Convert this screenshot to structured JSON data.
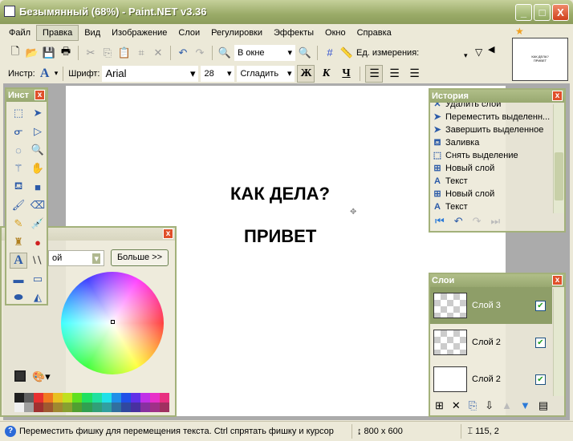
{
  "window": {
    "title": "Безымянный (68%) - Paint.NET v3.36",
    "min": "_",
    "max": "□",
    "close": "X"
  },
  "menu": [
    "Файл",
    "Правка",
    "Вид",
    "Изображение",
    "Слои",
    "Регулировки",
    "Эффекты",
    "Окно",
    "Справка"
  ],
  "menu_active": "Правка",
  "toolbar": {
    "zoom_value": "В окне",
    "units_label": "Ед. измерения:"
  },
  "textbar": {
    "tool_label": "Инстр:",
    "font_label": "Шрифт:",
    "font_value": "Arial",
    "size_value": "28",
    "antialias_value": "Сгладить",
    "bold": "Ж",
    "italic": "К",
    "underline": "Ч"
  },
  "thumbnail": {
    "line1": "КАК ДЕЛА?",
    "line2": "ПРИВЕТ"
  },
  "canvas": {
    "text1": "КАК ДЕЛА?",
    "text2": "ПРИВЕТ"
  },
  "tools_panel": {
    "title": "Инст",
    "close": "x"
  },
  "colors_panel": {
    "mode_value": "ой",
    "more_button": "Больше >>",
    "close": "x",
    "palette_top": [
      "#202020",
      "#606060",
      "#e83030",
      "#f07820",
      "#e8c020",
      "#c0e020",
      "#60e020",
      "#20e060",
      "#20e0a0",
      "#20e0e8",
      "#2090e8",
      "#2050e8",
      "#6030e8",
      "#c030e8",
      "#e830c8",
      "#e83080"
    ],
    "palette_bottom": [
      "#f0f0f0",
      "#a0a0a0",
      "#a03030",
      "#a05830",
      "#a08830",
      "#88a030",
      "#50a030",
      "#30a050",
      "#30a078",
      "#30a0a0",
      "#3070a0",
      "#3048a0",
      "#4830a0",
      "#8830a0",
      "#a03088",
      "#a03060"
    ]
  },
  "history_panel": {
    "title": "История",
    "close": "x",
    "items": [
      {
        "icon": "delete-layer",
        "label": "Удалить слой"
      },
      {
        "icon": "move-selection",
        "label": "Переместить выделенн..."
      },
      {
        "icon": "finish-selection",
        "label": "Завершить выделенное"
      },
      {
        "icon": "fill",
        "label": "Заливка"
      },
      {
        "icon": "deselect",
        "label": "Снять выделение"
      },
      {
        "icon": "new-layer",
        "label": "Новый слой"
      },
      {
        "icon": "text",
        "label": "Текст"
      },
      {
        "icon": "new-layer",
        "label": "Новый слой"
      },
      {
        "icon": "text",
        "label": "Текст"
      }
    ]
  },
  "layers_panel": {
    "title": "Слои",
    "close": "x",
    "layers": [
      {
        "name": "Слой 3",
        "visible": true,
        "selected": true
      },
      {
        "name": "Слой 2",
        "visible": true,
        "selected": false
      },
      {
        "name": "Слой 2",
        "visible": true,
        "selected": false
      }
    ]
  },
  "status": {
    "message": "Переместить фишку для перемещения текста. Ctrl спрятать фишку и курсор",
    "image_size": "800 x 600",
    "cursor_pos": "115, 2"
  },
  "colors": {
    "titlebar": "#9aab68",
    "accent": "#a3b17a",
    "selected_layer": "#8e9e68"
  }
}
